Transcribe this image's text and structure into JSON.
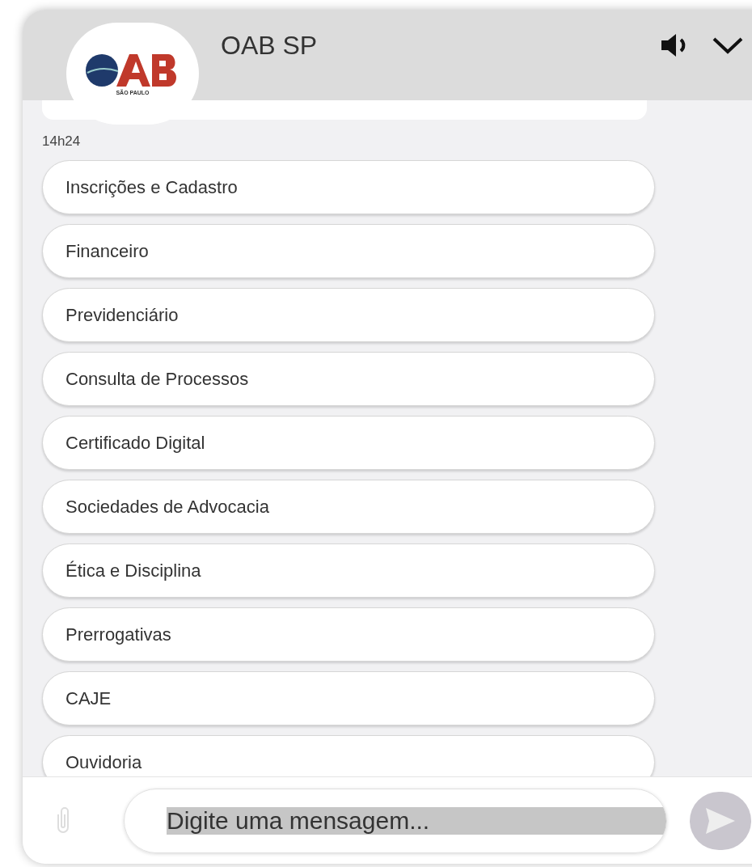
{
  "header": {
    "title": "OAB SP",
    "logo_caption": "SÃO PAULO"
  },
  "messages": {
    "time": "14h24",
    "options": [
      {
        "label": "Inscrições e Cadastro"
      },
      {
        "label": "Financeiro"
      },
      {
        "label": "Previdenciário"
      },
      {
        "label": "Consulta de Processos"
      },
      {
        "label": "Certificado Digital"
      },
      {
        "label": "Sociedades de Advocacia"
      },
      {
        "label": "Ética e Disciplina"
      },
      {
        "label": "Prerrogativas"
      },
      {
        "label": "CAJE"
      },
      {
        "label": "Ouvidoria"
      }
    ]
  },
  "composer": {
    "placeholder": "Digite uma mensagem..."
  }
}
